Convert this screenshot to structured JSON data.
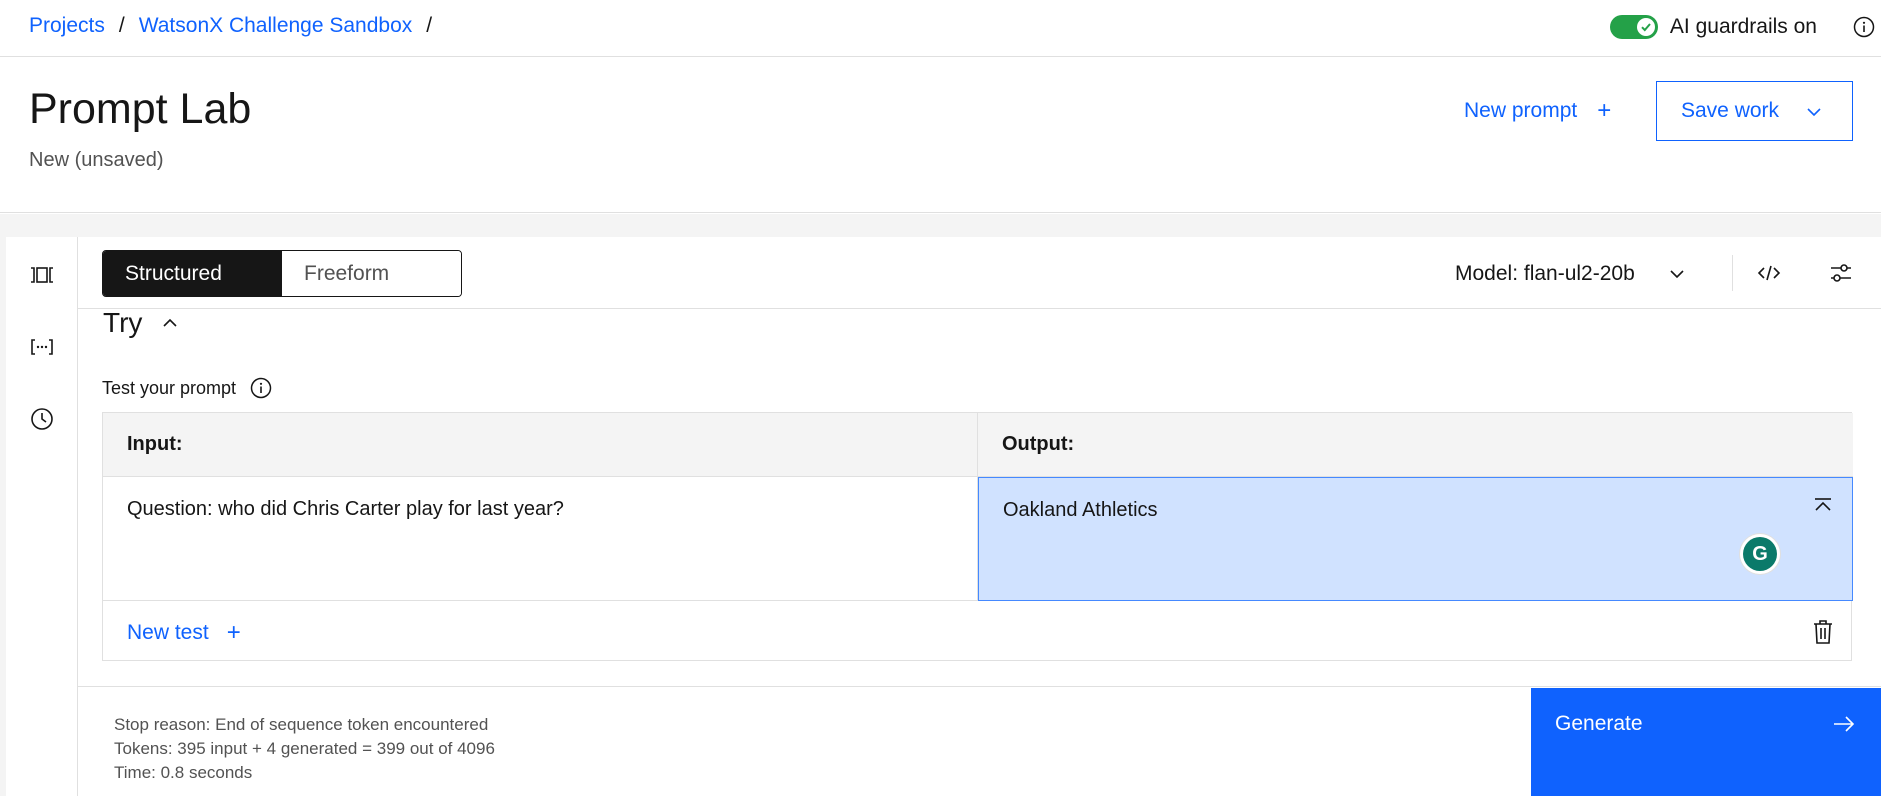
{
  "breadcrumb": {
    "items": [
      "Projects",
      "WatsonX Challenge Sandbox"
    ],
    "separator": "/"
  },
  "guardrails": {
    "label": "AI guardrails on",
    "enabled": true
  },
  "header": {
    "title": "Prompt Lab",
    "subtitle": "New (unsaved)",
    "new_prompt_label": "New prompt",
    "save_work_label": "Save work"
  },
  "toolbar": {
    "modes": [
      "Structured",
      "Freeform"
    ],
    "active_mode": "Structured",
    "model_label": "Model: flan-ul2-20b"
  },
  "try": {
    "heading": "Try",
    "test_label": "Test your prompt",
    "input_header": "Input:",
    "output_header": "Output:",
    "input_value": "Question: who did Chris Carter play for last year?",
    "output_value": "Oakland Athletics",
    "new_test_label": "New test",
    "grammarly_letter": "G"
  },
  "footer": {
    "stop_reason": "Stop reason: End of sequence token encountered",
    "tokens": "Tokens: 395 input + 4 generated = 399 out of 4096",
    "time": "Time: 0.8 seconds",
    "generate_label": "Generate"
  },
  "colors": {
    "accent": "#0f62fe",
    "toggle_on": "#24a148",
    "output_highlight": "#d0e2ff"
  }
}
